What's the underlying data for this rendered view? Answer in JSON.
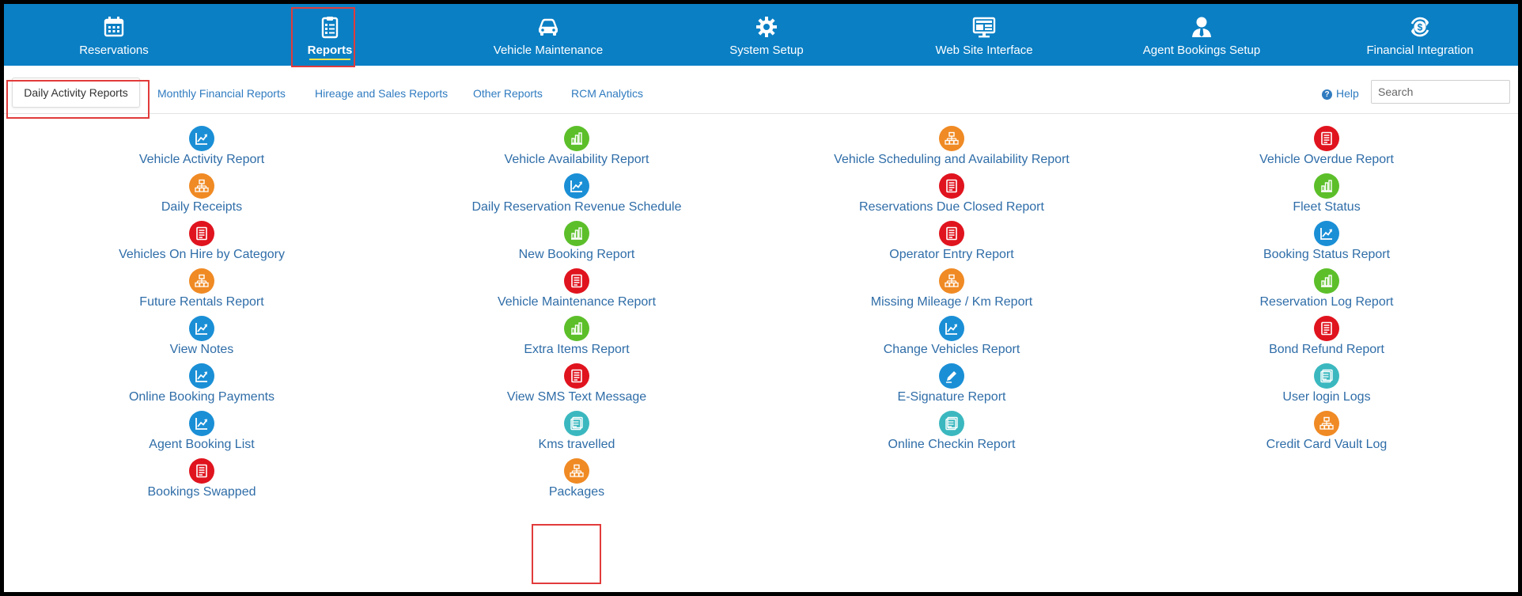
{
  "nav": {
    "items": [
      {
        "label": "Reservations",
        "icon": "calendar-icon"
      },
      {
        "label": "Reports",
        "icon": "clipboard-icon",
        "active": true
      },
      {
        "label": "Vehicle Maintenance",
        "icon": "car-icon"
      },
      {
        "label": "System Setup",
        "icon": "gear-icon"
      },
      {
        "label": "Web Site Interface",
        "icon": "monitor-icon"
      },
      {
        "label": "Agent Bookings Setup",
        "icon": "agent-icon"
      },
      {
        "label": "Financial Integration",
        "icon": "dollar-cycle-icon"
      }
    ]
  },
  "subtabs": {
    "items": [
      {
        "label": "Daily Activity Reports",
        "active": true
      },
      {
        "label": "Monthly Financial Reports"
      },
      {
        "label": "Hireage and Sales Reports"
      },
      {
        "label": "Other Reports"
      },
      {
        "label": "RCM Analytics"
      }
    ],
    "help_label": "Help",
    "search_placeholder": "Search"
  },
  "colors": {
    "nav_bg": "#0a7fc4",
    "blue": "#1a8fd6",
    "green": "#5cbf2a",
    "orange": "#f08a24",
    "red": "#e0141e",
    "teal": "#3bb8bf",
    "link": "#2f6da8",
    "highlight": "#e23b3b"
  },
  "reports": {
    "columns": [
      [
        {
          "label": "Vehicle Activity Report",
          "icon": "line-chart-icon",
          "color": "blue"
        },
        {
          "label": "Daily Receipts",
          "icon": "org-chart-icon",
          "color": "orange"
        },
        {
          "label": "Vehicles On Hire by Category",
          "icon": "document-icon",
          "color": "red"
        },
        {
          "label": "Future Rentals Report",
          "icon": "org-chart-icon",
          "color": "orange"
        },
        {
          "label": "View Notes",
          "icon": "line-chart-icon",
          "color": "blue"
        },
        {
          "label": "Online Booking Payments",
          "icon": "line-chart-icon",
          "color": "blue"
        },
        {
          "label": "Agent Booking List",
          "icon": "line-chart-icon",
          "color": "blue"
        },
        {
          "label": "Bookings Swapped",
          "icon": "document-icon",
          "color": "red"
        }
      ],
      [
        {
          "label": "Vehicle Availability Report",
          "icon": "bar-chart-icon",
          "color": "green"
        },
        {
          "label": "Daily Reservation Revenue Schedule",
          "icon": "line-chart-icon",
          "color": "blue"
        },
        {
          "label": "New Booking Report",
          "icon": "bar-chart-icon",
          "color": "green"
        },
        {
          "label": "Vehicle Maintenance Report",
          "icon": "document-icon",
          "color": "red"
        },
        {
          "label": "Extra Items Report",
          "icon": "bar-chart-icon",
          "color": "green"
        },
        {
          "label": "View SMS Text Message",
          "icon": "document-icon",
          "color": "red"
        },
        {
          "label": "Kms travelled",
          "icon": "list-icon",
          "color": "teal"
        },
        {
          "label": "Packages",
          "icon": "org-chart-icon",
          "color": "orange"
        }
      ],
      [
        {
          "label": "Vehicle Scheduling and Availability Report",
          "icon": "org-chart-icon",
          "color": "orange"
        },
        {
          "label": "Reservations Due Closed Report",
          "icon": "document-icon",
          "color": "red"
        },
        {
          "label": "Operator Entry Report",
          "icon": "document-icon",
          "color": "red"
        },
        {
          "label": "Missing Mileage / Km Report",
          "icon": "org-chart-icon",
          "color": "orange"
        },
        {
          "label": "Change Vehicles Report",
          "icon": "line-chart-icon",
          "color": "blue"
        },
        {
          "label": "E-Signature Report",
          "icon": "pen-icon",
          "color": "blue"
        },
        {
          "label": "Online Checkin Report",
          "icon": "list-icon",
          "color": "teal"
        }
      ],
      [
        {
          "label": "Vehicle Overdue Report",
          "icon": "document-icon",
          "color": "red"
        },
        {
          "label": "Fleet Status",
          "icon": "bar-chart-icon",
          "color": "green"
        },
        {
          "label": "Booking Status Report",
          "icon": "line-chart-icon",
          "color": "blue"
        },
        {
          "label": "Reservation Log Report",
          "icon": "bar-chart-icon",
          "color": "green"
        },
        {
          "label": "Bond Refund Report",
          "icon": "document-icon",
          "color": "red"
        },
        {
          "label": "User login Logs",
          "icon": "list-icon",
          "color": "teal"
        },
        {
          "label": "Credit Card Vault Log",
          "icon": "org-chart-icon",
          "color": "orange"
        }
      ]
    ]
  }
}
